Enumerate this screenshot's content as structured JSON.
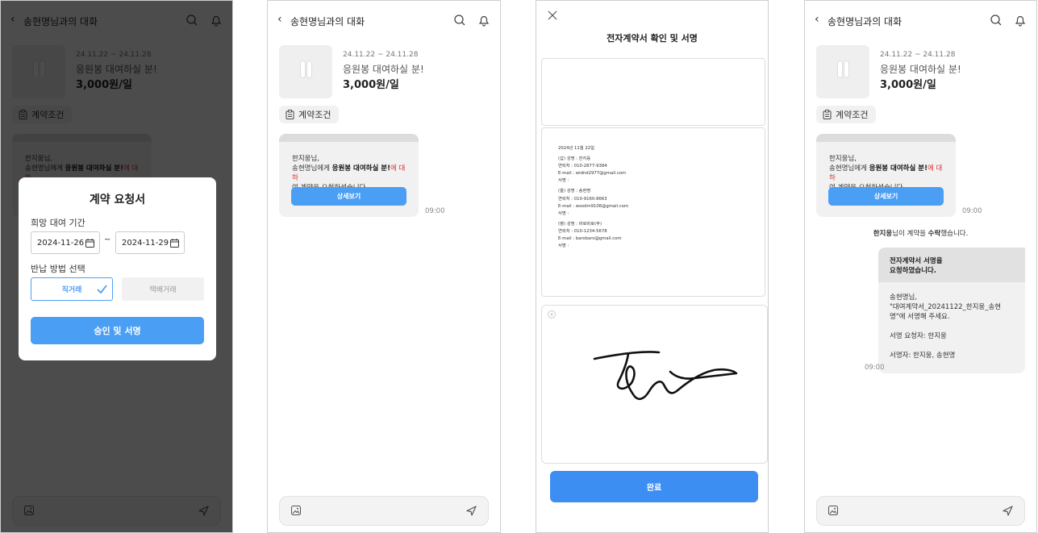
{
  "colors": {
    "accent": "#4a9ff5",
    "done_button": "#3d8ef2",
    "overlay": "rgba(0,0,0,0.7)"
  },
  "chat": {
    "title": "송현명님과의 대화",
    "back_icon": "chevron-left-icon",
    "product": {
      "date_range": "24.11.22 ~ 24.11.28",
      "name": "응원봉 대여하실 분!",
      "price": "3,000원/일"
    },
    "contract_terms_label": "계약조건",
    "message": {
      "line1": "한지웅님,",
      "line2_prefix": "송현명님에게 ",
      "line2_bold": "응원봉 대여하실 분!",
      "line2_suffix": "에 대하",
      "line3": "여 계약을 요청하셨습니다.",
      "detail_button": "상세보기",
      "time": "09:00"
    }
  },
  "modal": {
    "title": "계약 요청서",
    "period_label": "희망 대여 기간",
    "start_date": "2024-11-26",
    "separator": "~",
    "end_date": "2024-11-29",
    "return_label": "반납 방법 선택",
    "option_direct": "직거래",
    "option_delivery": "택배거래",
    "approve_button": "승인 및 서명"
  },
  "contract": {
    "title": "전자계약서 확인 및 서명",
    "doc_lines": [
      "2024년 11월 22일",
      "",
      "(갑) 성명    : 한지웅",
      "연락처    : 010-2877-9384",
      "E-mail    : widnd2977@gmail.com",
      "서명    :",
      "",
      "(을) 성명    : 송현명",
      "연락처    : 010-9160-8663",
      "E-mail    : wsodm9106@gmail.com",
      "서명    :",
      "",
      "(병) 성명    : 바로바로(주)",
      "연락처    : 010-1234-5678",
      "E-mail    : barobaro@gmail.com",
      "서명    :"
    ],
    "sig_clear": "×",
    "done_button": "완료"
  },
  "result": {
    "accept_name": "한지웅",
    "accept_mid": "님이 계약을 ",
    "accept_bold": "수락",
    "accept_end": "했습니다.",
    "request": {
      "header_line1": "전자계약서 서명을",
      "header_line2": "요청하였습니다.",
      "body_line1": "송현명님,",
      "body_line2": "\"대여계약서_20241122_한지웅_송현",
      "body_line3": "명\"에 서명해 주세요.",
      "requester": "서명 요청자: 한지웅",
      "signers": "서명자: 한지웅, 송현명",
      "time": "09:00"
    }
  }
}
